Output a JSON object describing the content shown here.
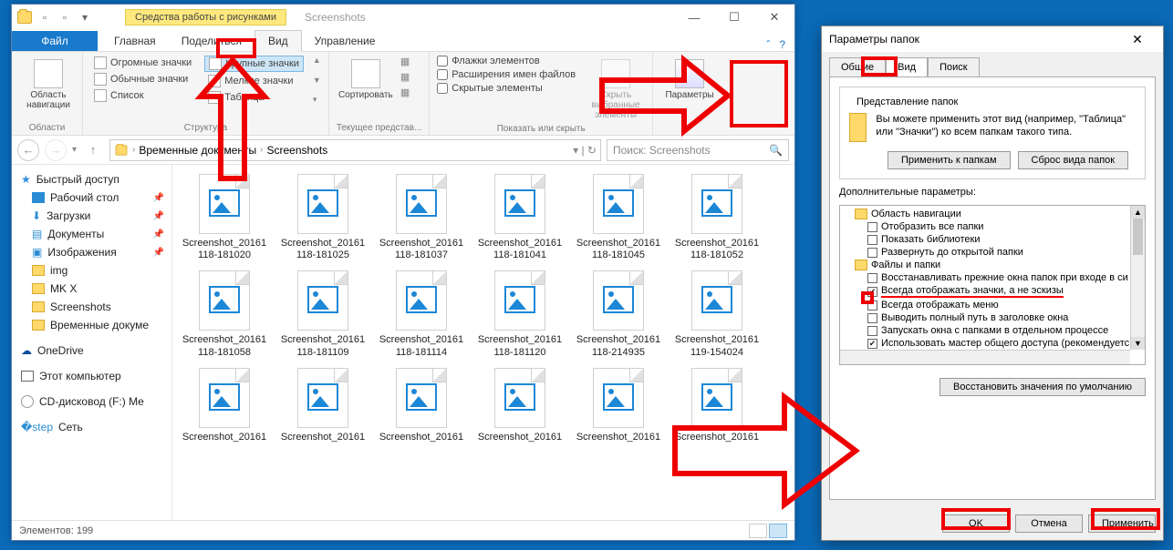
{
  "explorer": {
    "context_tab": "Средства работы с рисунками",
    "window_title": "Screenshots",
    "tabs": {
      "file": "Файл",
      "home": "Главная",
      "share": "Поделиться",
      "view": "Вид",
      "manage": "Управление"
    },
    "ribbon": {
      "panes_btn": "Область навигации",
      "panes_group": "Области",
      "layout": {
        "huge": "Огромные значки",
        "large": "Крупные значки",
        "normal": "Обычные значки",
        "small": "Мелкие значки",
        "list": "Список",
        "table": "Таблица"
      },
      "layout_group": "Структура",
      "sort_btn": "Сортировать",
      "view_group": "Текущее представ...",
      "check_flags": "Флажки элементов",
      "check_ext": "Расширения имен файлов",
      "check_hidden": "Скрытые элементы",
      "hide_btn": "Скрыть выбранные элементы",
      "show_group": "Показать или скрыть",
      "options_btn": "Параметры"
    },
    "breadcrumb": {
      "p1": "Временные документы",
      "p2": "Screenshots"
    },
    "search_placeholder": "Поиск: Screenshots",
    "sidebar": {
      "quick": "Быстрый доступ",
      "desktop": "Рабочий стол",
      "downloads": "Загрузки",
      "documents": "Документы",
      "pictures": "Изображения",
      "img": "img",
      "mkx": "MK X",
      "screenshots": "Screenshots",
      "temp": "Временные докуме",
      "onedrive": "OneDrive",
      "thispc": "Этот компьютер",
      "cd": "CD-дисковод (F:) Me",
      "network": "Сеть"
    },
    "files": [
      "Screenshot_20161118-181020",
      "Screenshot_20161118-181025",
      "Screenshot_20161118-181037",
      "Screenshot_20161118-181041",
      "Screenshot_20161118-181045",
      "Screenshot_20161118-181052",
      "Screenshot_20161118-181058",
      "Screenshot_20161118-181109",
      "Screenshot_20161118-181114",
      "Screenshot_20161118-181120",
      "Screenshot_20161118-214935",
      "Screenshot_20161119-154024",
      "Screenshot_20161",
      "Screenshot_20161",
      "Screenshot_20161",
      "Screenshot_20161",
      "Screenshot_20161",
      "Screenshot_20161"
    ],
    "status": "Элементов: 199"
  },
  "dialog": {
    "title": "Параметры папок",
    "tabs": {
      "general": "Общие",
      "view": "Вид",
      "search": "Поиск"
    },
    "fs_title": "Представление папок",
    "fs_text": "Вы можете применить этот вид (например, \"Таблица\" или \"Значки\") ко всем папкам такого типа.",
    "apply_folders": "Применить к папкам",
    "reset_folders": "Сброс вида папок",
    "adv_label": "Дополнительные параметры:",
    "nodes": {
      "nav": "Область навигации",
      "show_all": "Отобразить все папки",
      "show_libs": "Показать библиотеки",
      "expand": "Развернуть до открытой папки",
      "files": "Файлы и папки",
      "restore_win": "Восстанавливать прежние окна папок при входе в си",
      "always_icons": "Всегда отображать значки, а не эскизы",
      "always_menu": "Всегда отображать меню",
      "full_path": "Выводить полный путь в заголовке окна",
      "separate": "Запускать окна с папками в отдельном процессе",
      "sharing": "Использовать мастер общего доступа (рекомендуетс"
    },
    "restore_defaults": "Восстановить значения по умолчанию",
    "ok": "OK",
    "cancel": "Отмена",
    "apply": "Применить"
  }
}
